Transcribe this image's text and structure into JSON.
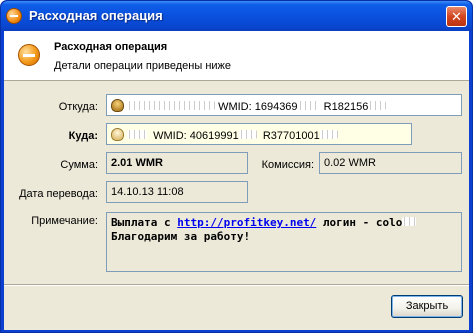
{
  "window": {
    "title": "Расходная операция",
    "close_glyph": "✕"
  },
  "header": {
    "title": "Расходная операция",
    "subtitle": "Детали операции приведены ниже"
  },
  "fields": {
    "from": {
      "label": "Откуда:",
      "wmid_text": "WMID: 1694369",
      "purse_text": "R182156"
    },
    "to": {
      "label": "Куда:",
      "wmid_text": "WMID: 40619991",
      "purse_text": "R37701001"
    },
    "amount": {
      "label": "Сумма:",
      "value": "2.01 WMR"
    },
    "fee": {
      "label": "Комиссия:",
      "value": "0.02 WMR"
    },
    "date": {
      "label": "Дата перевода:",
      "value": "14.10.13 11:08"
    },
    "note": {
      "label": "Примечание:",
      "prefix": "Выплата с ",
      "link": "http://profitkey.net/",
      "middle": " логин - colo",
      "line2": "Благодарим за работу!"
    }
  },
  "buttons": {
    "close_label": "Закрыть"
  },
  "colors": {
    "titlebar": "#0a52e0",
    "dialog_bg": "#ece9d8",
    "link": "#0000ee"
  }
}
